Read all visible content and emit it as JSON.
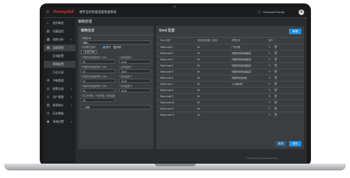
{
  "topbar": {
    "menu_icon": "≡",
    "brand": "Honeywell",
    "app_title": "楼宇自控智能温度管理系统",
    "bell_icon": "☐",
    "user_name": "Honeywell Family",
    "avatar": "A"
  },
  "sidebar": {
    "items": [
      {
        "icon": "⌂",
        "label": "首页概览",
        "caret": ""
      },
      {
        "icon": "▤",
        "label": "设备监控",
        "caret": ""
      },
      {
        "icon": "▦",
        "label": "趋势分析",
        "caret": "v"
      },
      {
        "icon": "▣",
        "label": "温度管理",
        "caret": "^"
      },
      {
        "label": "区域配置"
      },
      {
        "label": "策略配置"
      },
      {
        "label": "日志记录"
      },
      {
        "icon": "⚙",
        "label": "节能管理",
        "caret": ""
      },
      {
        "icon": "◎",
        "label": "报警记录",
        "caret": "v"
      },
      {
        "icon": "♙",
        "label": "用户管理",
        "caret": "v"
      },
      {
        "icon": "▥",
        "label": "报表统计",
        "caret": "v"
      },
      {
        "icon": "◷",
        "label": "历史数据",
        "caret": ""
      },
      {
        "icon": "◉",
        "label": "系统设置",
        "caret": "v"
      }
    ]
  },
  "main": {
    "page_title": "策略管理"
  },
  "left_panel": {
    "title": "策略信息",
    "name_label": "* 策略名称",
    "name_value": "策略1",
    "mode_label": "* 控制模式选择",
    "mode_opt1": "制冷",
    "mode_opt2": "制热",
    "add_btn": "+ 新增时间段",
    "blocks": [
      {
        "l1": "* 开始时间/结束时间（24h）",
        "v1": "00",
        "l2": "* 目标温度/℃",
        "v2": "24.00"
      },
      {
        "l1": "* 开始时间/结束时间（24h）",
        "v1": "00",
        "l2": "* 目标温度/℃",
        "v2": "26.00"
      },
      {
        "l1": "* 开始时间/结束时间（24h）",
        "v1": "00",
        "l2": "* 目标温度/℃",
        "v2": "24.00"
      },
      {
        "l1": "* 开始时间/结束时间（24h）",
        "v1": "00",
        "l2": "* 目标温度/℃",
        "v2": "24.00"
      }
    ],
    "extra_label": "* 非工作时段（下班时段）目标温度",
    "extra_value": "26",
    "expand_row": "> 其他"
  },
  "right_panel": {
    "title": "Shed 配置",
    "add_btn": "新增",
    "headers": [
      "Shed 名称",
      "目标回风温度（按钮）",
      "关联区域",
      "操作"
    ],
    "rows": [
      {
        "name": "Shed Level 1",
        "val": "50",
        "area": "广东大厦"
      },
      {
        "name": "Shed Level 2",
        "val": "50",
        "area": "中国风系统远端监控"
      },
      {
        "name": "Shed Level 3",
        "val": "50",
        "area": "中国风系统远端监控"
      },
      {
        "name": "Shed Level 4",
        "val": "50",
        "area": "中国风系统远端监控"
      },
      {
        "name": "Shed Level 5",
        "val": "50",
        "area": "中国风系统远端监控"
      },
      {
        "name": "Shed Level 6",
        "val": "50",
        "area": "中国风系统远端"
      },
      {
        "name": "Shed Level 7",
        "val": "50",
        "area": "十九层机房"
      },
      {
        "name": "Shed Level 8",
        "val": "50",
        "area": ""
      },
      {
        "name": "Shed Level 9",
        "val": "50",
        "area": ""
      },
      {
        "name": "Shed Level 10",
        "val": "50",
        "area": ""
      },
      {
        "name": "Shed Level 11",
        "val": "50",
        "area": ""
      },
      {
        "name": "Shed Level 12",
        "val": "50",
        "area": ""
      }
    ],
    "edit_icon": "✎",
    "delete_icon": "🗑",
    "cancel_btn": "取消",
    "save_btn": "保存"
  },
  "footer": {
    "copyright": "© 2020 Honeywell International Inc."
  },
  "colors": {
    "accent": "#1e8ee8",
    "brand": "#e0302a",
    "panel": "#3a3e41"
  }
}
